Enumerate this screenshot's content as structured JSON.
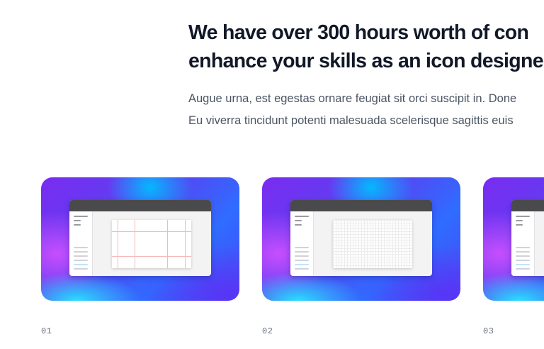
{
  "hero": {
    "headline_line1": "We have over 300 hours worth of con",
    "headline_line2": "enhance your skills as an icon designe",
    "subtext_line1": "Augue urna, est egestas ornare feugiat sit orci suscipit in. Done",
    "subtext_line2": "Eu viverra tincidunt potenti malesuada scelerisque sagittis euis"
  },
  "cards": [
    {
      "number": "01",
      "preview": "app-window-with-layout-guides"
    },
    {
      "number": "02",
      "preview": "app-window-with-pixel-grid"
    },
    {
      "number": "03",
      "preview": "app-window"
    }
  ],
  "colors": {
    "heading": "#111827",
    "body_text": "#4b5563",
    "card_gradient_start": "#7a2cf0",
    "card_gradient_end": "#2f6cff",
    "guide_line": "#f7b8b8"
  }
}
